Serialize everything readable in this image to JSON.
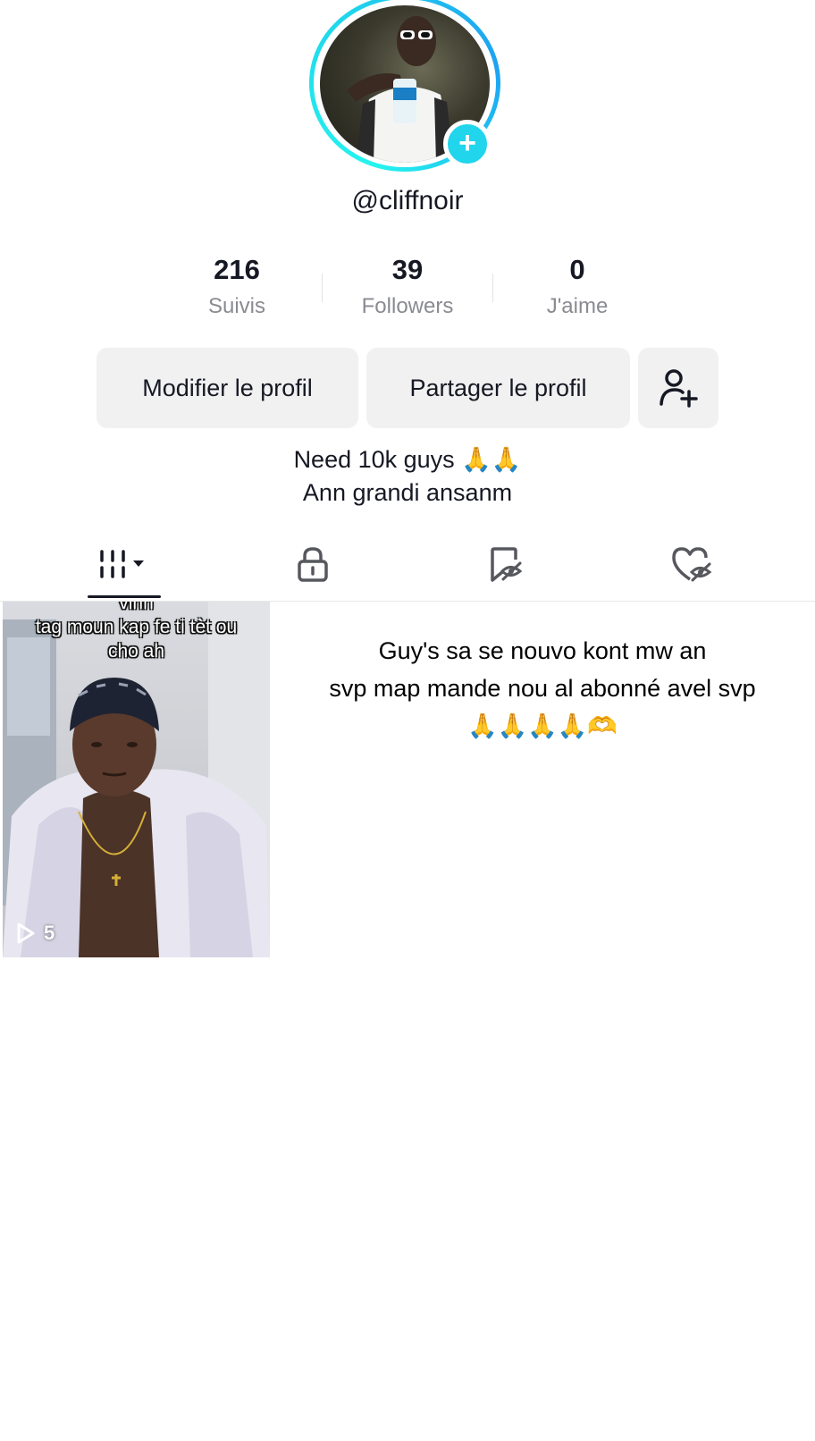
{
  "profile": {
    "username": "@cliffnoir",
    "add_badge": "+",
    "stats": [
      {
        "value": "216",
        "label": "Suivis"
      },
      {
        "value": "39",
        "label": "Followers"
      },
      {
        "value": "0",
        "label": "J'aime"
      }
    ],
    "buttons": {
      "edit_profile": "Modifier le profil",
      "share_profile": "Partager le profil"
    },
    "bio": [
      "Need 10k guys 🙏🙏",
      "Ann grandi ansanm"
    ]
  },
  "tabs": [
    {
      "icon": "videos-grid-icon",
      "active": true
    },
    {
      "icon": "lock-icon",
      "active": false
    },
    {
      "icon": "bookmark-hidden-icon",
      "active": false
    },
    {
      "icon": "liked-hidden-icon",
      "active": false
    }
  ],
  "videos": [
    {
      "caption_lines": [
        "vinn",
        "tag moun kap fe ti tèt ou",
        "cho ah"
      ],
      "views": "5"
    }
  ],
  "post_text": [
    "Guy's sa se nouvo kont mw an",
    "svp map mande nou al abonné avel svp",
    "🙏🙏🙏🙏🫶"
  ],
  "colors": {
    "accent_cyan": "#20d5ec",
    "text_primary": "#161823",
    "text_secondary": "#8a8b91",
    "button_bg": "#f1f1f2"
  }
}
